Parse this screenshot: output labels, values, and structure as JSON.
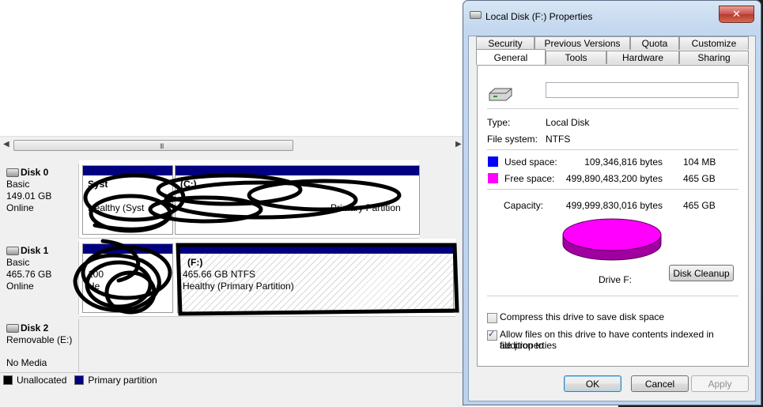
{
  "disk_management": {
    "disks": [
      {
        "name": "Disk 0",
        "type": "Basic",
        "size": "149.01 GB",
        "status": "Online",
        "partitions": [
          {
            "line1": "Syst",
            "line1b": "rved",
            "line2": "",
            "line3": "Healthy (Syst"
          },
          {
            "line1": "(C:)",
            "line2": "",
            "line3": "Primary Partition"
          }
        ]
      },
      {
        "name": "Disk 1",
        "type": "Basic",
        "size": "465.76 GB",
        "status": "Online",
        "partitions": [
          {
            "line1": "",
            "line1b": "",
            "line2": "100",
            "line3": "He"
          },
          {
            "line1": "(F:)",
            "line2": "465.66 GB NTFS",
            "line3": "Healthy (Primary Partition)"
          }
        ]
      },
      {
        "name": "Disk 2",
        "type": "Removable (E:)",
        "size": "",
        "status": "No Media"
      }
    ],
    "legend": [
      {
        "label": "Unallocated",
        "color": "#000000"
      },
      {
        "label": "Primary partition",
        "color": "#000080"
      }
    ]
  },
  "dialog": {
    "title": "Local Disk (F:) Properties",
    "close_label": "✕",
    "tabs_back": [
      "Security",
      "Previous Versions",
      "Quota",
      "Customize"
    ],
    "tabs_front": [
      "General",
      "Tools",
      "Hardware",
      "Sharing"
    ],
    "active_tab": "General",
    "general": {
      "volume_label_value": "",
      "type_label": "Type:",
      "type_value": "Local Disk",
      "fs_label": "File system:",
      "fs_value": "NTFS",
      "used_label": "Used space:",
      "used_bytes": "109,346,816 bytes",
      "used_short": "104 MB",
      "free_label": "Free space:",
      "free_bytes": "499,890,483,200 bytes",
      "free_short": "465 GB",
      "capacity_label": "Capacity:",
      "capacity_bytes": "499,999,830,016 bytes",
      "capacity_short": "465 GB",
      "drive_label": "Drive F:",
      "cleanup_label": "Disk Cleanup",
      "compress_label": "Compress this drive to save disk space",
      "compress_checked": false,
      "index_label_1": "Allow files on this drive to have contents indexed in addition to",
      "index_label_2": "file properties",
      "index_checked": true,
      "used_color": "#0000ff",
      "free_color": "#ff00ff",
      "used_fraction": 0.0002
    },
    "buttons": {
      "ok": "OK",
      "cancel": "Cancel",
      "apply": "Apply"
    }
  }
}
